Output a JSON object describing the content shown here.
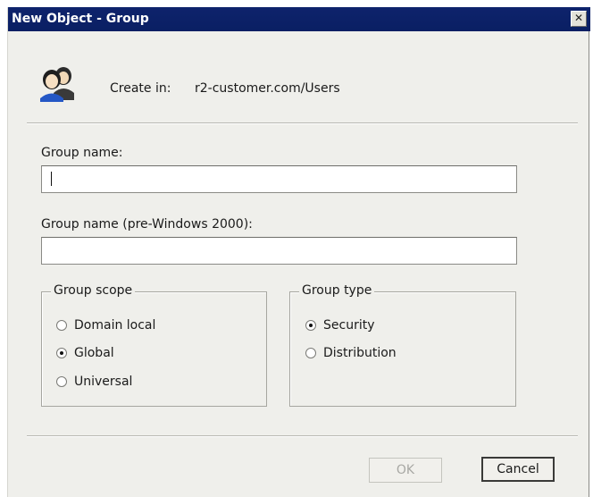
{
  "window": {
    "title": "New Object - Group",
    "close_glyph": "✕"
  },
  "header": {
    "icon": "users-group-icon",
    "create_in_label": "Create in:",
    "create_in_value": "r2-customer.com/Users"
  },
  "fields": {
    "group_name_label": "Group name:",
    "group_name_value": "",
    "pre2000_label": "Group name (pre-Windows 2000):",
    "pre2000_value": ""
  },
  "group_scope": {
    "legend": "Group scope",
    "options": [
      {
        "label": "Domain local",
        "checked": false
      },
      {
        "label": "Global",
        "checked": true
      },
      {
        "label": "Universal",
        "checked": false
      }
    ]
  },
  "group_type": {
    "legend": "Group type",
    "options": [
      {
        "label": "Security",
        "checked": true
      },
      {
        "label": "Distribution",
        "checked": false
      }
    ]
  },
  "buttons": {
    "ok_label": "OK",
    "ok_enabled": false,
    "cancel_label": "Cancel"
  }
}
